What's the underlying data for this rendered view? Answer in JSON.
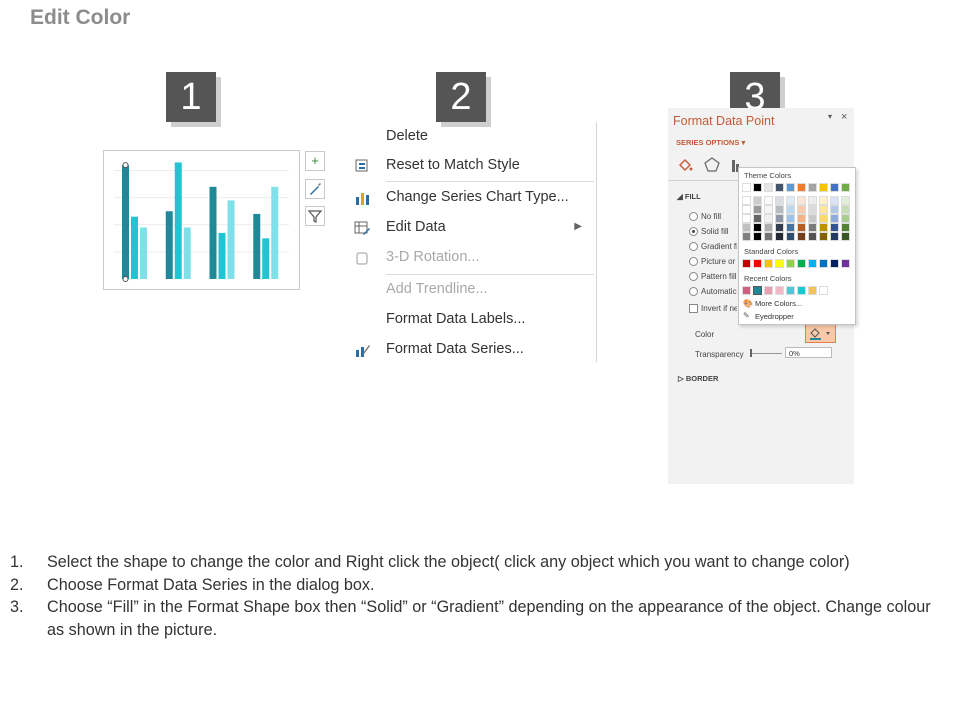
{
  "title": "Edit Color",
  "steps": [
    "1",
    "2",
    "3"
  ],
  "context_menu": {
    "items": [
      {
        "label": "Delete",
        "icon": "none",
        "disabled": false
      },
      {
        "label": "Reset to Match Style",
        "icon": "reset-style-icon",
        "disabled": false
      },
      {
        "label": "Change Series Chart Type...",
        "icon": "bar-chart-icon",
        "disabled": false
      },
      {
        "label": "Edit Data",
        "icon": "edit-data-icon",
        "disabled": false,
        "submenu": true
      },
      {
        "label": "3-D Rotation...",
        "icon": "rotation-icon",
        "disabled": true
      },
      {
        "label": "Add Trendline...",
        "icon": "none",
        "disabled": true
      },
      {
        "label": "Format Data Labels...",
        "icon": "none",
        "disabled": false
      },
      {
        "label": "Format Data Series...",
        "icon": "format-series-icon",
        "disabled": false
      }
    ]
  },
  "format_pane": {
    "title": "Format Data Point",
    "series_options": "SERIES OPTIONS",
    "fill_header": "FILL",
    "fill_options": [
      "No fill",
      "Solid fill",
      "Gradient fill",
      "Picture or texture fill",
      "Pattern fill",
      "Automatic"
    ],
    "invert": "Invert if negative",
    "color_label": "Color",
    "transparency_label": "Transparency",
    "transparency_value": "0%",
    "border_header": "BORDER"
  },
  "color_popup": {
    "theme_label": "Theme Colors",
    "standard_label": "Standard Colors",
    "recent_label": "Recent Colors",
    "more_colors": "More Colors...",
    "eyedropper": "Eyedropper",
    "theme_top": [
      "#ffffff",
      "#000000",
      "#e7e6e6",
      "#44546a",
      "#5b9bd5",
      "#ed7d31",
      "#a5a5a5",
      "#ffc000",
      "#4472c4",
      "#70ad47"
    ],
    "standard": [
      "#c00000",
      "#ff0000",
      "#ffc000",
      "#ffff00",
      "#92d050",
      "#00b050",
      "#00b0f0",
      "#0070c0",
      "#002060",
      "#7030a0"
    ],
    "recent": [
      "#d06080",
      "#1e8a99",
      "#e6a2b0",
      "#f2b8c6",
      "#4ec9d3",
      "#22c4d4",
      "#f2c25b",
      "#ffffff"
    ]
  },
  "chart_buttons": [
    "+",
    "brush",
    "filter"
  ],
  "instructions": [
    {
      "num": "1.",
      "text": "Select the shape to change the color and Right click the object( click any object which you want to change color)"
    },
    {
      "num": "2.",
      "text": "Choose Format Data Series in the dialog box."
    },
    {
      "num": "3.",
      "text": "Choose “Fill” in the Format Shape box then “Solid” or “Gradient” depending on the appearance of the object. Change colour as shown in the picture."
    }
  ],
  "chart_data": {
    "type": "bar",
    "categories": [
      "",
      "",
      "",
      ""
    ],
    "series": [
      {
        "values": [
          4.2,
          2.5,
          3.4,
          2.4
        ]
      },
      {
        "values": [
          2.3,
          4.3,
          1.7,
          1.5
        ]
      },
      {
        "values": [
          1.9,
          1.9,
          2.9,
          3.4
        ]
      }
    ],
    "colors": [
      "#1e8a99",
      "#22c4d4",
      "#7fe0e8"
    ],
    "ylim": [
      0,
      4.5
    ],
    "grid": true
  }
}
